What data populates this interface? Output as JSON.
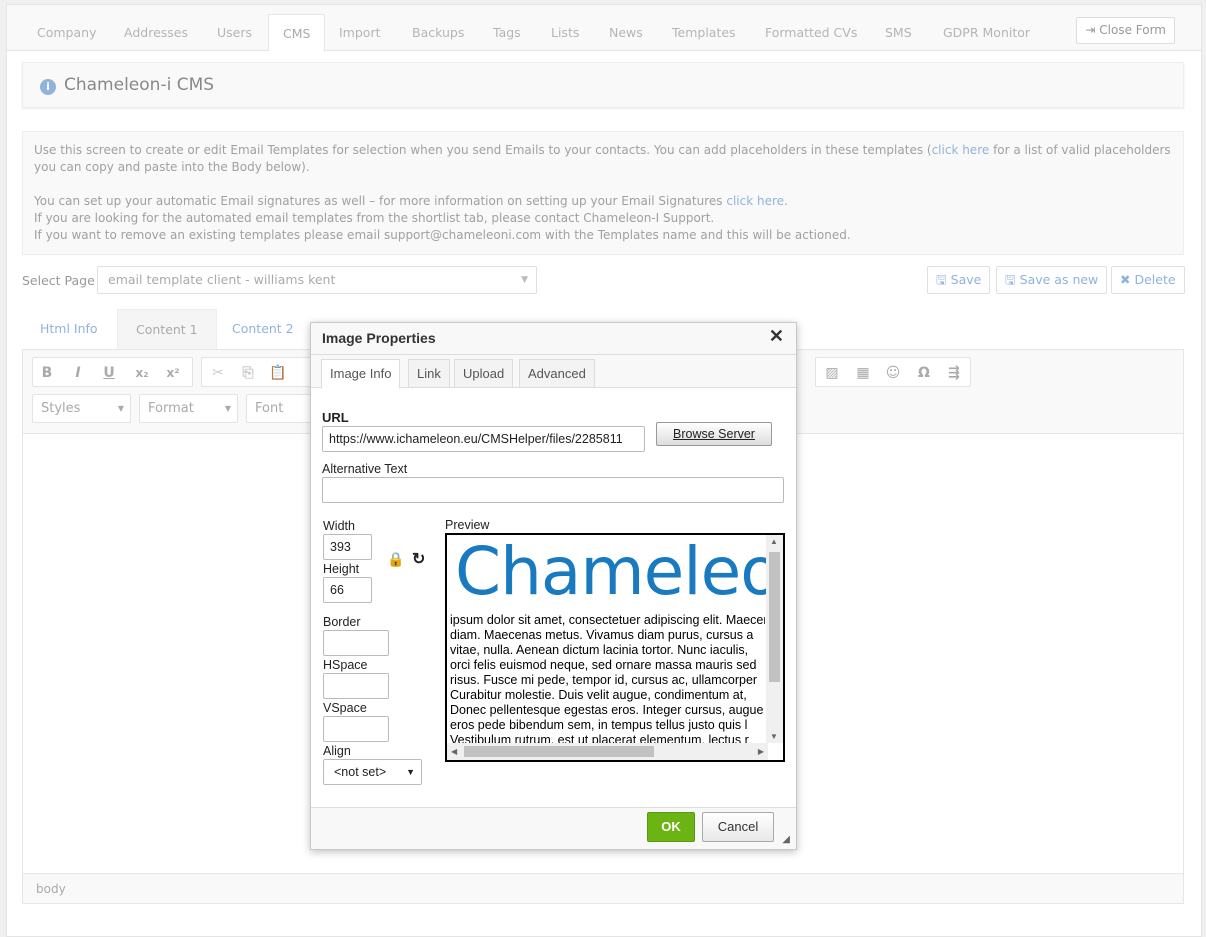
{
  "nav": {
    "tabs": [
      "Company",
      "Addresses",
      "Users",
      "CMS",
      "Import",
      "Backups",
      "Tags",
      "Lists",
      "News",
      "Templates",
      "Formatted CVs",
      "SMS",
      "GDPR Monitor"
    ],
    "active": "CMS",
    "close_form": "Close Form"
  },
  "header": {
    "title": "Chameleon-i CMS"
  },
  "notice": {
    "p1a": "Use this screen to create or edit Email Templates for selection when you send Emails to your contacts. You can add placeholders in these templates (",
    "link1": "click here",
    "p1b": " for a list of valid placeholders you can copy and paste into the Body below).",
    "p2a": "You can set up your automatic Email signatures as well – for more information on setting up your Email Signatures ",
    "link2": "click here",
    "p2b": ".",
    "p3": "If you are looking for the automated email templates from the shortlist tab, please contact Chameleon-I Support.",
    "p4": "If you want to remove an existing templates please email support@chameleoni.com with the Templates name and this will be actioned."
  },
  "select_page": {
    "label": "Select Page",
    "value": "email template client - williams kent"
  },
  "actions": {
    "save": "Save",
    "save_new": "Save as new",
    "delete": "Delete"
  },
  "editor_tabs": [
    "Html Info",
    "Content 1",
    "Content 2"
  ],
  "toolbar": {
    "styles": "Styles",
    "format": "Format",
    "font": "Font"
  },
  "status": {
    "path": "body"
  },
  "dialog": {
    "title": "Image Properties",
    "tabs": [
      "Image Info",
      "Link",
      "Upload",
      "Advanced"
    ],
    "url_label": "URL",
    "url_value": "https://www.ichameleon.eu/CMSHelper/files/2285811",
    "browse": "Browse Server",
    "alt_label": "Alternative Text",
    "alt_value": "",
    "width_label": "Width",
    "width_value": "393",
    "height_label": "Height",
    "height_value": "66",
    "border_label": "Border",
    "hspace_label": "HSpace",
    "vspace_label": "VSpace",
    "align_label": "Align",
    "align_value": "<not set>",
    "preview_label": "Preview",
    "preview_logo": "Chameleo",
    "preview_lines": [
      "ipsum dolor sit amet, consectetuer adipiscing elit. Maecenas",
      "diam. Maecenas metus. Vivamus diam purus, cursus a",
      "vitae, nulla. Aenean dictum lacinia tortor. Nunc iaculis,",
      "orci felis euismod neque, sed ornare massa mauris sed",
      "risus. Fusce mi pede, tempor id, cursus ac, ullamcorper",
      "Curabitur molestie. Duis velit augue, condimentum at,",
      "Donec pellentesque egestas eros. Integer cursus, augue",
      "eros pede bibendum sem, in tempus tellus justo quis l",
      "Vestibulum rutrum, est ut placerat elementum, lectus r"
    ],
    "ok": "OK",
    "cancel": "Cancel"
  },
  "colors": {
    "accent": "#8fb3dc",
    "ok_green": "#6cb314",
    "logo_blue": "#1a7abf"
  }
}
